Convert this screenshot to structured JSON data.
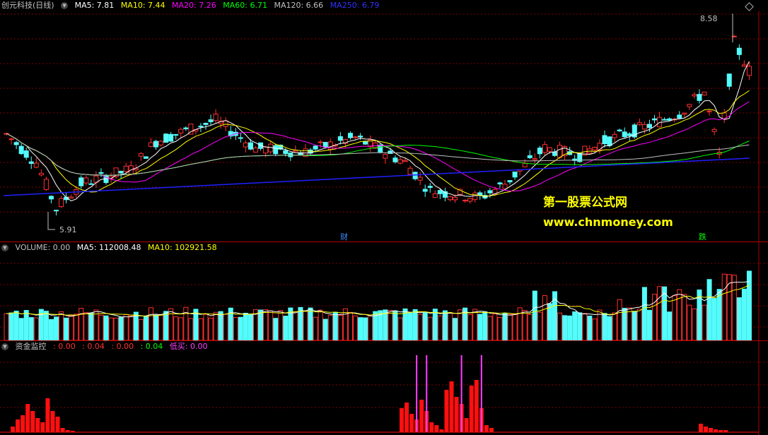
{
  "main_panel": {
    "stock_name": "创元科技(日线)",
    "ma": [
      {
        "label": "MA5: 7.81",
        "color": "#ffffff"
      },
      {
        "label": "MA10: 7.44",
        "color": "#ffff00"
      },
      {
        "label": "MA20: 7.26",
        "color": "#ff00ff"
      },
      {
        "label": "MA60: 6.71",
        "color": "#00ff00"
      },
      {
        "label": "MA120: 6.66",
        "color": "#c0c0c0"
      },
      {
        "label": "MA250: 6.79",
        "color": "#0000ff"
      }
    ],
    "high_label": "8.58",
    "low_label": "5.91",
    "marker_cai": "财",
    "marker_die": "跌",
    "watermark_cn": "第一股票公式网",
    "watermark_url": "www.chnmoney.com"
  },
  "volume_panel": {
    "label": "VOLUME: 0.00",
    "ma5": "MA5: 112008.48",
    "ma10": "MA10: 102921.58"
  },
  "money_panel": {
    "title": "资金监控",
    "values": [
      {
        "label": ": 0.00",
        "color": "#ff3030"
      },
      {
        "label": ": 0.04",
        "color": "#ff3030"
      },
      {
        "label": ": 0.00",
        "color": "#ff3030"
      },
      {
        "label": ": 0.04",
        "color": "#00ff00"
      },
      {
        "label": "低买: 0.00",
        "color": "#ff40ff"
      }
    ]
  },
  "colors": {
    "up": "#ff3030",
    "down": "#54fcfc",
    "grid": "#800000"
  }
}
